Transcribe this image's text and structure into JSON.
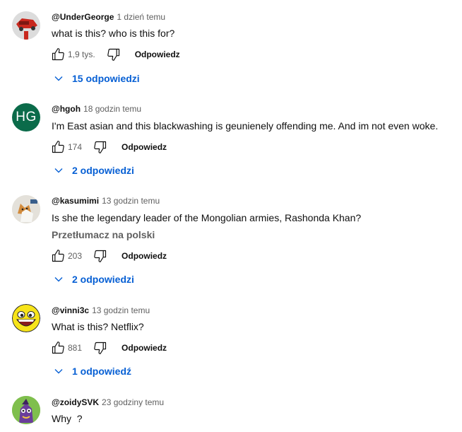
{
  "colors": {
    "link": "#065fd4",
    "secondary": "#606060",
    "primary": "#0f0f0f"
  },
  "comments": [
    {
      "author": "@UnderGeorge",
      "time": "1 dzień temu",
      "text": "what is this? who is this for?",
      "likes": "1,9 tys.",
      "reply_label": "Odpowiedz",
      "replies_label": "15 odpowiedzi",
      "avatar_icon": "red-car-avatar"
    },
    {
      "author": "@hgoh",
      "time": "18 godzin temu",
      "text": "I'm East asian and this blackwashing is geunienely offending me. And im not even woke.",
      "likes": "174",
      "reply_label": "Odpowiedz",
      "replies_label": "2 odpowiedzi",
      "avatar_initials": "HG",
      "avatar_color": "#0b6b4a"
    },
    {
      "author": "@kasumimi",
      "time": "13 godzin temu",
      "text": "Is she the legendary leader of the Mongolian armies, Rashonda Khan?",
      "translate_label": "Przetłumacz na polski",
      "likes": "203",
      "reply_label": "Odpowiedz",
      "replies_label": "2 odpowiedzi",
      "avatar_icon": "cat-avatar"
    },
    {
      "author": "@vinni3c",
      "time": "13 godzin temu",
      "text": "What is this? Netflix?",
      "likes": "881",
      "reply_label": "Odpowiedz",
      "replies_label": "1 odpowiedź",
      "avatar_icon": "smiley-face-avatar"
    },
    {
      "author": "@zoidySVK",
      "time": "23 godziny temu",
      "text": "Why  ?",
      "avatar_icon": "purple-creature-avatar"
    }
  ]
}
